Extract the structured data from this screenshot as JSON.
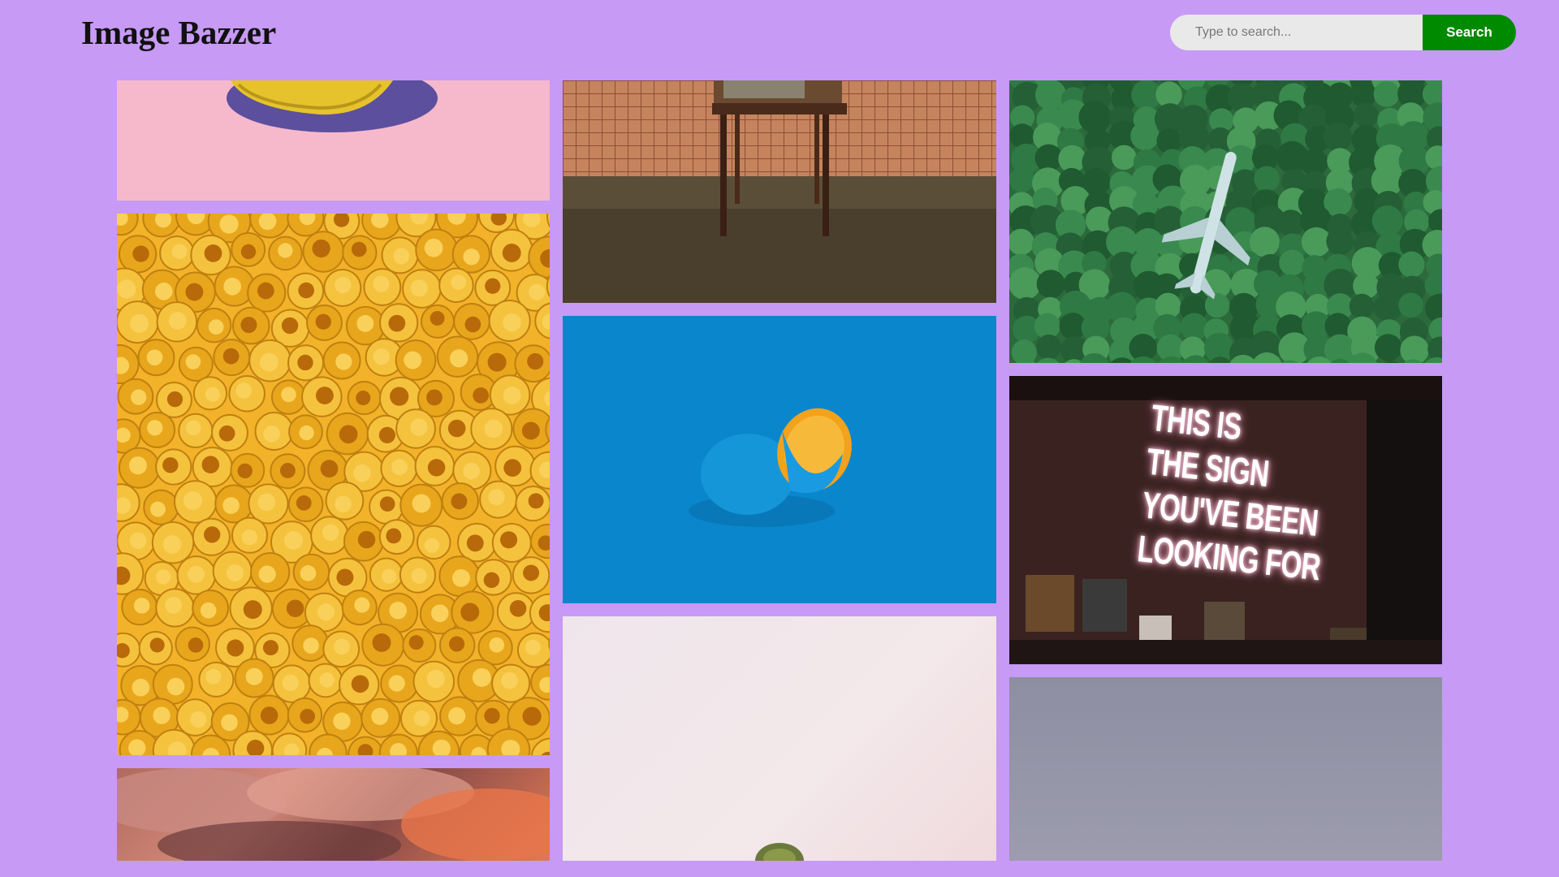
{
  "header": {
    "brand": "Image Bazzer",
    "search_placeholder": "Type to search...",
    "search_button": "Search"
  },
  "colors": {
    "page_background": "#c79af5",
    "search_button": "#008a00",
    "search_input": "#e9e9e9"
  },
  "gallery": {
    "photos": [
      {
        "subject": "banana on pink background"
      },
      {
        "subject": "pile of yellow toy heads"
      },
      {
        "subject": "pink clouds"
      },
      {
        "subject": "retro tv on wooden chair"
      },
      {
        "subject": "blue painted orange on blue background"
      },
      {
        "subject": "cactus on pale pink background"
      },
      {
        "subject": "airplane in forest aerial view"
      },
      {
        "subject": "neon sign on brick wall",
        "sign_text": "THIS IS\nTHE SIGN\nYOU'VE BEEN\nLOOKING FOR"
      },
      {
        "subject": "grey sky"
      }
    ]
  }
}
